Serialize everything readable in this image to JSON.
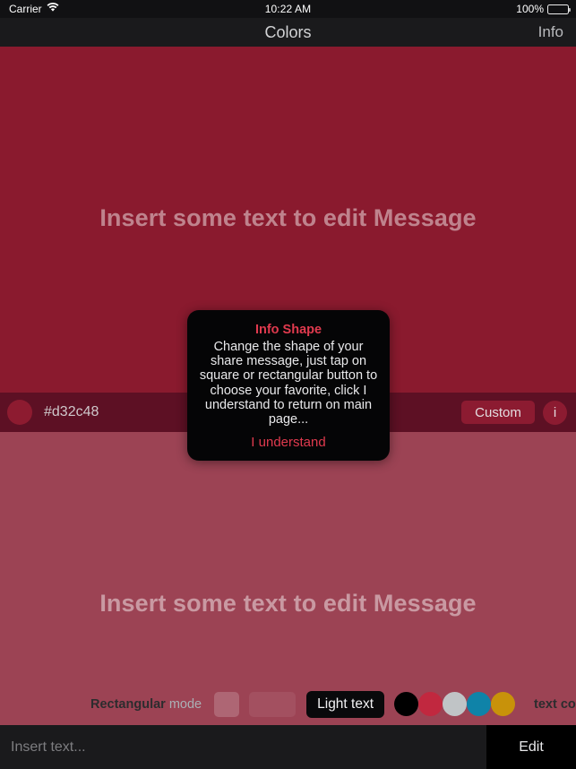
{
  "status_bar": {
    "carrier": "Carrier",
    "wifi_icon": "wifi-icon",
    "time": "10:22 AM",
    "battery_percent": "100%",
    "battery_icon": "battery-full-icon"
  },
  "nav_bar": {
    "title": "Colors",
    "right_button": "Info"
  },
  "canvas": {
    "top_message": "Insert some text to edit Message",
    "bottom_message": "Insert some text to edit Message",
    "top_background": "#8a1a2e",
    "bottom_background": "#9c4354"
  },
  "color_bar": {
    "swatch_color": "#8d1b30",
    "hex_value": "#d32c48",
    "custom_button": "Custom",
    "info_button": "i",
    "background": "#5d1024"
  },
  "tool_row": {
    "mode_label_bold": "Rectangular",
    "mode_label_rest": " mode",
    "shape_square_icon": "square-shape-button",
    "shape_rect_icon": "rectangle-shape-button",
    "light_text_button": "Light text",
    "text_color_label": "text color",
    "text_colors": [
      {
        "name": "black",
        "hex": "#000000"
      },
      {
        "name": "red",
        "hex": "#c1283f"
      },
      {
        "name": "light-gray",
        "hex": "#c0c4c6"
      },
      {
        "name": "teal",
        "hex": "#0f83a8"
      },
      {
        "name": "gold",
        "hex": "#c8920a"
      }
    ]
  },
  "input_bar": {
    "placeholder": "Insert text...",
    "value": "",
    "edit_button": "Edit"
  },
  "dialog": {
    "title": "Info Shape",
    "body": "Change the shape of your share message, just tap on square or rectangular button to choose your favorite, click I understand to return on main page...",
    "action": "I understand",
    "accent_color": "#e03a4e"
  }
}
